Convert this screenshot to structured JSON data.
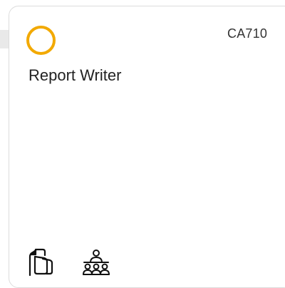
{
  "card": {
    "code": "CA710",
    "title": "Report Writer",
    "status_color": "#f2a900",
    "footer_icons": [
      "documents-icon",
      "group-icon"
    ]
  }
}
